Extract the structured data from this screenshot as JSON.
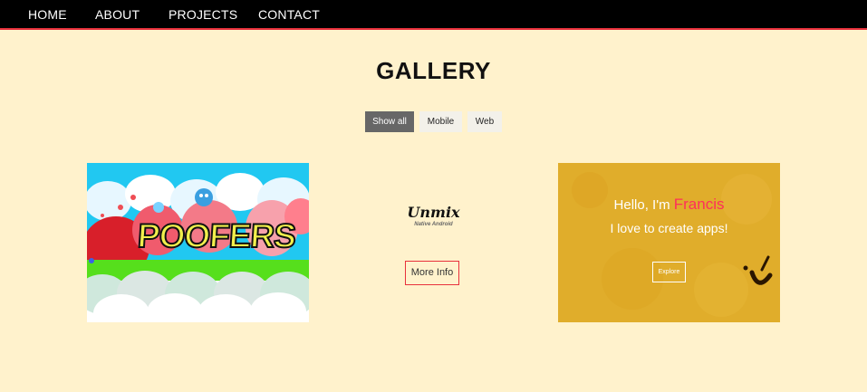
{
  "nav": {
    "items": [
      {
        "label": "HOME"
      },
      {
        "label": "ABOUT"
      },
      {
        "label": "PROJECTS"
      },
      {
        "label": "CONTACT"
      }
    ]
  },
  "gallery": {
    "title": "GALLERY",
    "filters": [
      {
        "label": "Show all",
        "active": true
      },
      {
        "label": "Mobile",
        "active": false
      },
      {
        "label": "Web",
        "active": false
      }
    ]
  },
  "cards": {
    "poofers": {
      "title": "POOFERS"
    },
    "unmix": {
      "title": "Unmix",
      "subtitle": "Native Android",
      "button": "More Info"
    },
    "francis": {
      "greeting": "Hello, I'm",
      "name": "Francis",
      "tagline": "I love to create apps!",
      "button": "Explore"
    }
  },
  "colors": {
    "background": "#fff2cc",
    "nav_background": "#000000",
    "accent": "#e8313c",
    "filter_active": "#676767",
    "filter_inactive": "#f3f1ea",
    "francis_background": "#e0ad2b",
    "francis_name": "#ff2f5a"
  }
}
